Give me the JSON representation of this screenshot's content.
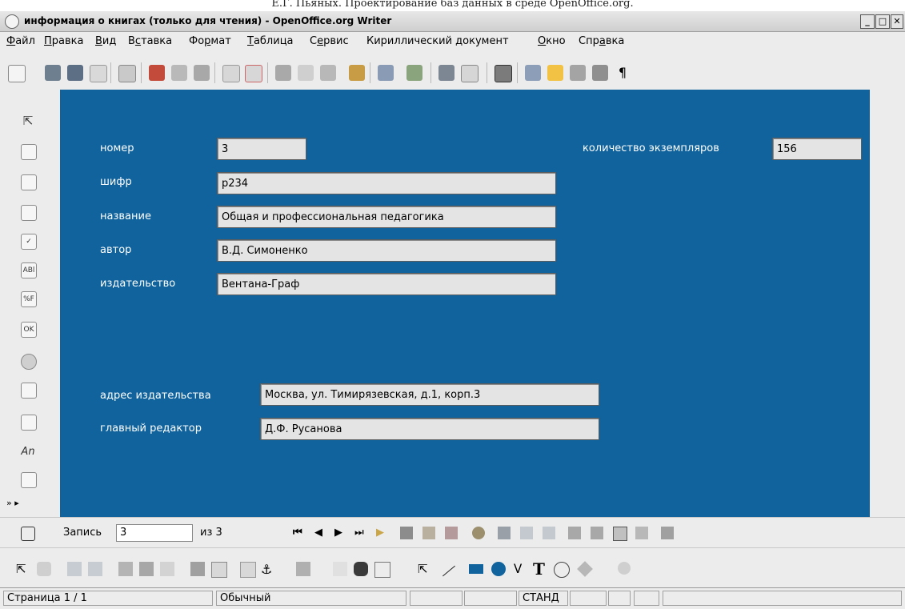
{
  "caption": "Е.Г. Пьяных. Проектирование баз данных в среде OpenOffice.org.",
  "window": {
    "title": "информация о книгах (только для чтения) - OpenOffice.org Writer",
    "minimize": "_",
    "maximize": "□",
    "close": "✕"
  },
  "menu": [
    {
      "label": "Файл",
      "accel": "Ф",
      "rest": "айл"
    },
    {
      "label": "Правка",
      "accel": "П",
      "rest": "равка"
    },
    {
      "label": "Вид",
      "accel": "В",
      "rest": "ид"
    },
    {
      "label": "Вставка",
      "pre": "В",
      "accel": "с",
      "rest": "тавка"
    },
    {
      "label": "Формат",
      "pre": "Фо",
      "accel": "р",
      "rest": "мат"
    },
    {
      "label": "Таблица",
      "accel": "Т",
      "rest": "аблица"
    },
    {
      "label": "Сервис",
      "pre": "С",
      "accel": "е",
      "rest": "рвис"
    },
    {
      "label": "Кириллический документ",
      "pre": "",
      "accel": "",
      "rest": "Кириллический документ"
    },
    {
      "label": "Окно",
      "accel": "О",
      "rest": "кно"
    },
    {
      "label": "Справка",
      "pre": "Спр",
      "accel": "а",
      "rest": "вка"
    }
  ],
  "form": {
    "fields": {
      "nomer": {
        "label": "номер",
        "value": "3"
      },
      "shifr": {
        "label": "шифр",
        "value": "р234"
      },
      "nazvanie": {
        "label": "название",
        "value": "Общая и профессиональная педагогика"
      },
      "avtor": {
        "label": "автор",
        "value": "В.Д. Симоненко"
      },
      "izdatelstvo": {
        "label": "издательство",
        "value": "Вентана-Граф"
      },
      "kolichestvo": {
        "label": "количество экземпляров",
        "value": "156"
      },
      "adres": {
        "label": "адрес издательства",
        "value": "Москва, ул. Тимирязевская, д.1, корп.3"
      },
      "redaktor": {
        "label": "главный редактор",
        "value": "Д.Ф. Русанова"
      }
    }
  },
  "navigation": {
    "record_label": "Запись",
    "record_value": "3",
    "of_label": "из 3"
  },
  "statusbar": {
    "page": "Страница  1 / 1",
    "style": "Обычный",
    "mode": "СТАНД"
  },
  "left_tools_text": {
    "text_icon": "An",
    "field_abl": "ABl",
    "field_pct": "%F",
    "field_ok": "OK"
  },
  "colors": {
    "form_background": "#10639d",
    "chrome": "#ececec",
    "field_background": "#e4e4e4",
    "label_text": "#ffffff"
  }
}
